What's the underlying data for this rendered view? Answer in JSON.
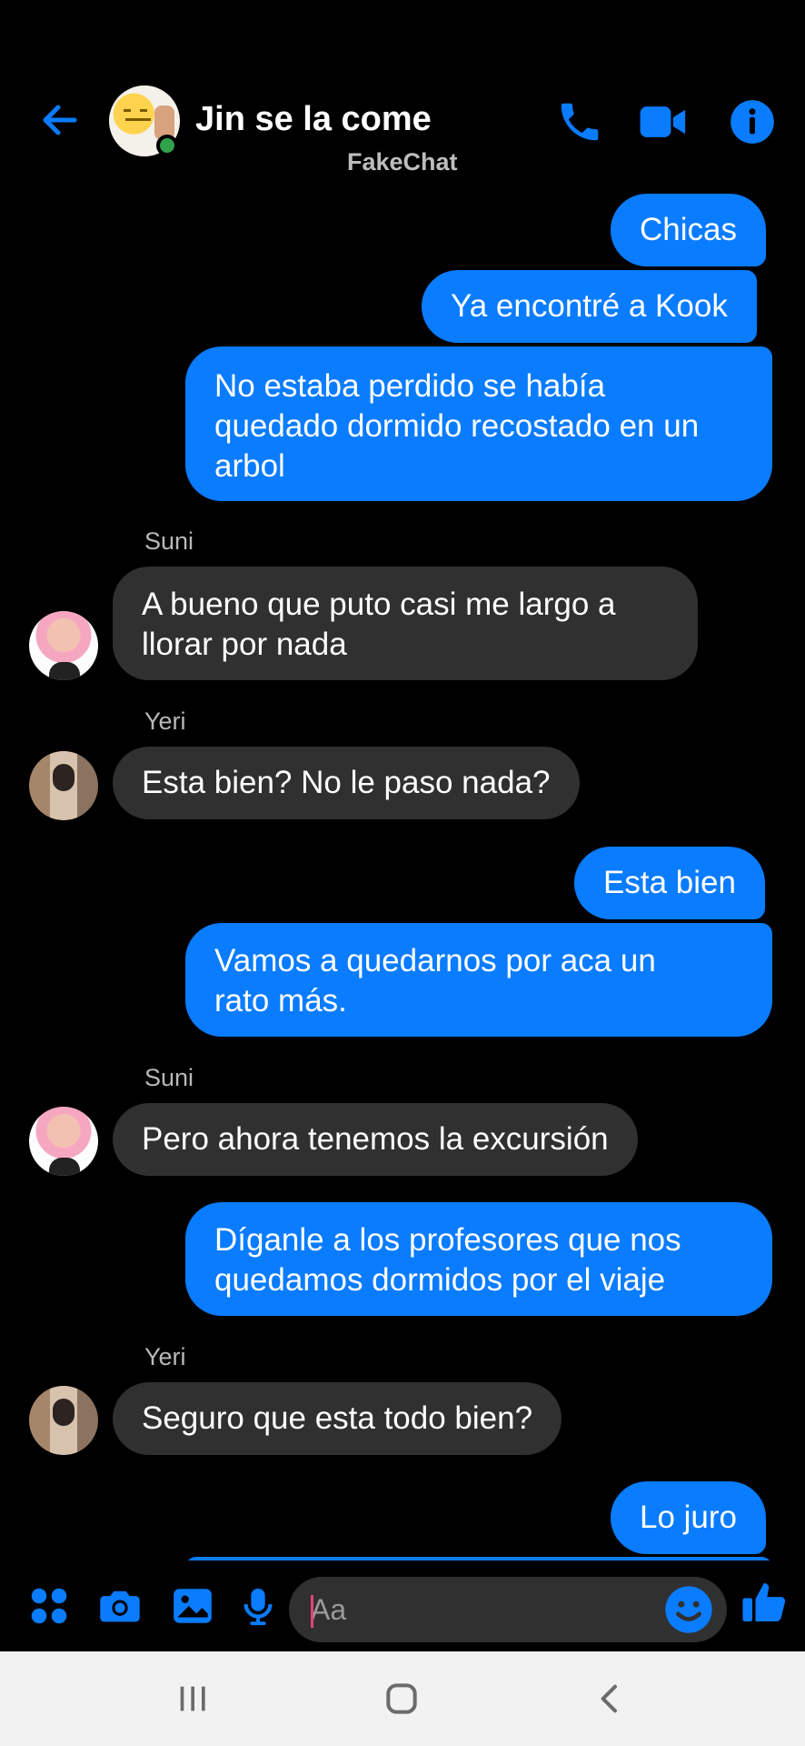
{
  "header": {
    "title": "Jin se la come",
    "subtitle": "FakeChat",
    "accent_color": "#0a7cff",
    "online_color": "#31a24c"
  },
  "messages": [
    {
      "id": 1,
      "direction": "outgoing",
      "text": "Chicas"
    },
    {
      "id": 2,
      "direction": "outgoing",
      "text": "Ya encontré a Kook"
    },
    {
      "id": 3,
      "direction": "outgoing",
      "lines": [
        "No estaba perdido se había",
        "quedado dormido recostado en un",
        "arbol"
      ]
    },
    {
      "id": 4,
      "direction": "incoming",
      "sender": "Suni",
      "lines": [
        "A bueno que puto casi me largo a",
        "llorar por nada"
      ]
    },
    {
      "id": 5,
      "direction": "incoming",
      "sender": "Yeri",
      "text": "Esta bien? No le paso nada?"
    },
    {
      "id": 6,
      "direction": "outgoing",
      "text": "Esta bien"
    },
    {
      "id": 7,
      "direction": "outgoing",
      "lines": [
        "Vamos a quedarnos por aca un",
        "rato más."
      ]
    },
    {
      "id": 8,
      "direction": "incoming",
      "sender": "Suni",
      "text": "Pero ahora tenemos la excursión"
    },
    {
      "id": 9,
      "direction": "outgoing",
      "lines": [
        "Díganle a los profesores que nos",
        "quedamos dormidos por el viaje"
      ]
    },
    {
      "id": 10,
      "direction": "incoming",
      "sender": "Yeri",
      "text": "Seguro que esta todo bien?"
    },
    {
      "id": 11,
      "direction": "outgoing",
      "text": "Lo juro"
    }
  ],
  "composer": {
    "placeholder": "Aa",
    "value": ""
  },
  "icons": {
    "back": "arrow-left-icon",
    "call": "phone-icon",
    "video": "video-camera-icon",
    "info": "info-icon",
    "menu": "four-dots-icon",
    "camera": "camera-icon",
    "gallery": "image-icon",
    "mic": "microphone-icon",
    "emoji": "smiley-icon",
    "like": "thumbs-up-icon"
  }
}
